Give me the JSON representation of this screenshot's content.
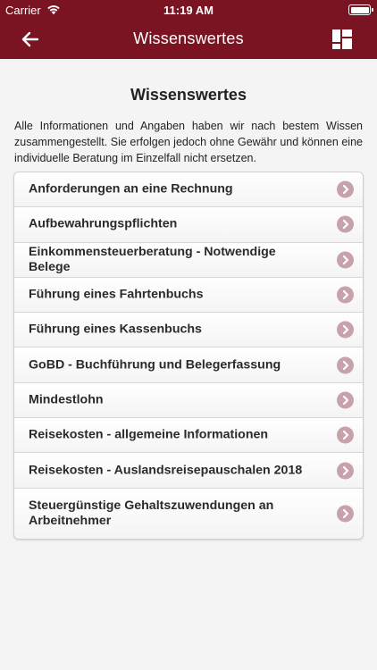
{
  "status_bar": {
    "carrier": "Carrier",
    "time": "11:19 AM"
  },
  "navbar": {
    "title": "Wissenswertes",
    "back_icon": "back-arrow-icon",
    "menu_icon": "grid-layout-icon"
  },
  "page": {
    "title": "Wissenswertes",
    "intro": "Alle Informationen und Angaben haben wir nach bestem Wissen zusammengestellt. Sie erfolgen jedoch ohne Gewähr und können eine individuelle Beratung im Einzelfall nicht ersetzen."
  },
  "list": {
    "items": [
      {
        "label": "Anforderungen an eine Rechnung"
      },
      {
        "label": "Aufbewahrungspflichten"
      },
      {
        "label": "Einkommensteuerberatung - Notwendige Belege"
      },
      {
        "label": "Führung eines Fahrtenbuchs"
      },
      {
        "label": "Führung eines Kassenbuchs"
      },
      {
        "label": "GoBD - Buchführung und Belegerfassung"
      },
      {
        "label": "Mindestlohn"
      },
      {
        "label": "Reisekosten - allgemeine Informationen"
      },
      {
        "label": "Reisekosten - Auslandsreisepauschalen 2018"
      },
      {
        "label": "Steuergünstige Gehaltszuwendungen an Arbeitnehmer"
      }
    ]
  },
  "colors": {
    "brand": "#7a1423",
    "chevron": "#c7a2aa"
  }
}
